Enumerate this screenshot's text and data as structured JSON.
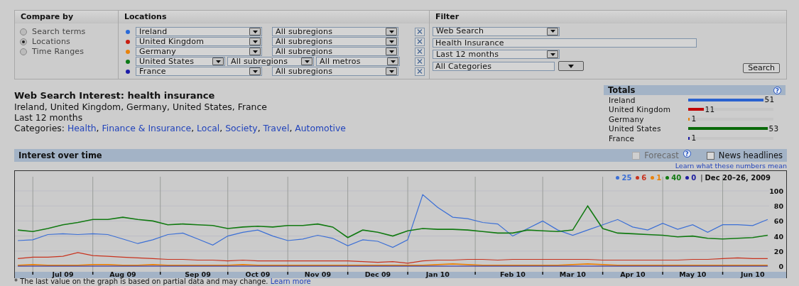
{
  "compare_by": {
    "title": "Compare by",
    "options": [
      {
        "label": "Search terms",
        "selected": false
      },
      {
        "label": "Locations",
        "selected": true
      },
      {
        "label": "Time Ranges",
        "selected": false
      }
    ]
  },
  "locations": {
    "title": "Locations",
    "rows": [
      {
        "kind": "region",
        "color": "#2a6ad8",
        "country": "Ireland",
        "subregion": "All subregions"
      },
      {
        "kind": "region",
        "color": "#c81e10",
        "country": "United Kingdom",
        "subregion": "All subregions"
      },
      {
        "kind": "region",
        "color": "#e8820c",
        "country": "Germany",
        "subregion": "All subregions"
      },
      {
        "kind": "metro",
        "color": "#0c7a16",
        "country": "United States",
        "subregion": "All subregions",
        "metro": "All metros"
      },
      {
        "kind": "region",
        "color": "#1c1ca8",
        "country": "France",
        "subregion": "All subregions"
      }
    ]
  },
  "filter": {
    "title": "Filter",
    "search_type": "Web Search",
    "query": "Health Insurance",
    "time_range": "Last 12 months",
    "category": "All Categories",
    "search_button": "Search"
  },
  "summary": {
    "title": "Web Search Interest: health insurance",
    "locations_line": "Ireland, United Kingdom, Germany, United States, France",
    "time_line": "Last 12 months",
    "categories_label": "Categories: ",
    "separator": ", ",
    "categories": [
      "Health",
      "Finance & Insurance",
      "Local",
      "Society",
      "Travel",
      "Automotive"
    ]
  },
  "totals": {
    "title": "Totals",
    "help": "?",
    "rows": [
      {
        "name": "Ireland",
        "color": "#2a62d0",
        "level": 0.88,
        "value": "51"
      },
      {
        "name": "United Kingdom",
        "color": "#c00000",
        "level": 0.18,
        "value": "11"
      },
      {
        "name": "Germany",
        "color": "#e8800a",
        "level": 0.02,
        "value": "1"
      },
      {
        "name": "United States",
        "color": "#0a6a0a",
        "level": 0.93,
        "value": "53"
      },
      {
        "name": "France",
        "color": "#1a1aa0",
        "level": 0.02,
        "value": "1"
      }
    ]
  },
  "interest": {
    "title": "Interest over time",
    "options": [
      {
        "label": "Forecast",
        "checked": false,
        "disabled": true,
        "help": "?"
      },
      {
        "label": "News headlines",
        "checked": false,
        "disabled": false
      }
    ],
    "learn_link": "Learn what these numbers mean",
    "legend": {
      "values": [
        "25",
        "6",
        "1",
        "40",
        "0"
      ],
      "separator": "|",
      "date": "Dec 20–26, 2009"
    },
    "chart_data": {
      "type": "line",
      "categories": [
        null,
        null,
        null,
        "Jul 09",
        null,
        null,
        null,
        "Aug 09",
        null,
        null,
        null,
        null,
        "Sep 09",
        null,
        null,
        null,
        "Oct 09",
        null,
        null,
        null,
        "Nov 09",
        null,
        null,
        null,
        "Dec 09",
        null,
        null,
        null,
        "Jan 10",
        null,
        null,
        null,
        null,
        "Feb 10",
        null,
        null,
        null,
        "Mar 10",
        null,
        null,
        null,
        "Apr 10",
        null,
        null,
        null,
        "May 10",
        null,
        null,
        null,
        "Jun 10",
        null
      ],
      "ylim": [
        0,
        100
      ],
      "yticks": [
        0,
        20,
        40,
        60,
        80,
        100
      ],
      "series": [
        {
          "color": "#3b6fd6",
          "values": [
            34,
            35,
            42,
            43,
            42,
            43,
            42,
            36,
            30,
            35,
            42,
            44,
            36,
            28,
            40,
            45,
            48,
            40,
            34,
            36,
            41,
            37,
            27,
            35,
            33,
            25,
            35,
            95,
            78,
            65,
            63,
            58,
            56,
            40,
            50,
            60,
            48,
            41,
            48,
            55,
            62,
            52,
            48,
            57,
            49,
            55,
            45,
            55,
            55,
            54,
            62
          ]
        },
        {
          "color": "#c8321e",
          "values": [
            10,
            12,
            12,
            13,
            18,
            14,
            13,
            12,
            11,
            10,
            9,
            9,
            8,
            8,
            7,
            8,
            7,
            7,
            7,
            7,
            7,
            7,
            7,
            6,
            5,
            6,
            4,
            7,
            8,
            8,
            9,
            9,
            8,
            9,
            9,
            9,
            9,
            9,
            9,
            8,
            8,
            8,
            8,
            8,
            8,
            9,
            9,
            10,
            11,
            10,
            10
          ]
        },
        {
          "color": "#e8820c",
          "values": [
            1,
            2,
            1,
            1,
            1,
            2,
            2,
            1,
            1,
            2,
            1,
            1,
            1,
            1,
            1,
            2,
            1,
            1,
            1,
            1,
            1,
            1,
            1,
            1,
            1,
            1,
            1,
            1,
            2,
            3,
            2,
            1,
            1,
            1,
            1,
            1,
            1,
            2,
            3,
            2,
            1,
            1,
            1,
            1,
            1,
            1,
            1,
            1,
            1,
            1,
            1
          ]
        },
        {
          "color": "#127a12",
          "values": [
            48,
            46,
            50,
            55,
            58,
            62,
            62,
            65,
            62,
            60,
            55,
            56,
            55,
            54,
            50,
            52,
            53,
            52,
            54,
            54,
            56,
            52,
            38,
            48,
            45,
            40,
            47,
            50,
            49,
            49,
            48,
            46,
            44,
            44,
            48,
            47,
            46,
            48,
            80,
            50,
            44,
            43,
            42,
            41,
            39,
            40,
            37,
            36,
            37,
            38,
            41
          ]
        },
        {
          "color": "#2020a0",
          "values": [
            0,
            0,
            0,
            0,
            0,
            0,
            0,
            0,
            0,
            0,
            0,
            0,
            0,
            0,
            0,
            0,
            0,
            0,
            0,
            0,
            0,
            0,
            0,
            0,
            0,
            0,
            0,
            0,
            0,
            0,
            0,
            0,
            0,
            0,
            0,
            0,
            0,
            0,
            0,
            0,
            0,
            0,
            0,
            0,
            0,
            0,
            0,
            0,
            0,
            0,
            0
          ]
        }
      ],
      "grid": true
    },
    "footnote": "* The last value on the graph is based on partial data and may change. ",
    "footnote_link": "Learn more"
  }
}
